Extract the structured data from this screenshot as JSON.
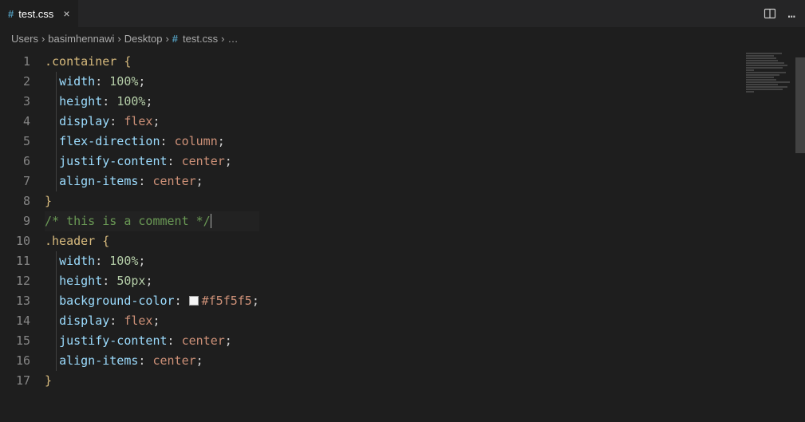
{
  "tab": {
    "icon_label": "#",
    "filename": "test.css",
    "close_glyph": "×"
  },
  "actions": {
    "split": "split-editor",
    "more": "…"
  },
  "breadcrumbs": {
    "seg1": "Users",
    "seg2": "basimhennawi",
    "seg3": "Desktop",
    "file_icon": "#",
    "seg4": "test.css",
    "tail": "…",
    "sep": "›"
  },
  "gutter": {
    "l1": "1",
    "l2": "2",
    "l3": "3",
    "l4": "4",
    "l5": "5",
    "l6": "6",
    "l7": "7",
    "l8": "8",
    "l9": "9",
    "l10": "10",
    "l11": "11",
    "l12": "12",
    "l13": "13",
    "l14": "14",
    "l15": "15",
    "l16": "16",
    "l17": "17"
  },
  "code": {
    "l1": {
      "selector": ".container",
      "sp": " ",
      "brace": "{"
    },
    "l2": {
      "indent": "  ",
      "prop": "width",
      "colon": ": ",
      "val": "100%",
      "semi": ";"
    },
    "l3": {
      "indent": "  ",
      "prop": "height",
      "colon": ": ",
      "val": "100%",
      "semi": ";"
    },
    "l4": {
      "indent": "  ",
      "prop": "display",
      "colon": ": ",
      "val": "flex",
      "semi": ";"
    },
    "l5": {
      "indent": "  ",
      "prop": "flex-direction",
      "colon": ": ",
      "val": "column",
      "semi": ";"
    },
    "l6": {
      "indent": "  ",
      "prop": "justify-content",
      "colon": ": ",
      "val": "center",
      "semi": ";"
    },
    "l7": {
      "indent": "  ",
      "prop": "align-items",
      "colon": ": ",
      "val": "center",
      "semi": ";"
    },
    "l8": {
      "brace": "}"
    },
    "l9": {
      "comment": "/* this is a comment */"
    },
    "l10": {
      "selector": ".header",
      "sp": " ",
      "brace": "{"
    },
    "l11": {
      "indent": "  ",
      "prop": "width",
      "colon": ": ",
      "val": "100%",
      "semi": ";"
    },
    "l12": {
      "indent": "  ",
      "prop": "height",
      "colon": ": ",
      "val": "50px",
      "semi": ";"
    },
    "l13": {
      "indent": "  ",
      "prop": "background-color",
      "colon": ": ",
      "swatch_color": "#f5f5f5",
      "val": "#f5f5f5",
      "semi": ";"
    },
    "l14": {
      "indent": "  ",
      "prop": "display",
      "colon": ": ",
      "val": "flex",
      "semi": ";"
    },
    "l15": {
      "indent": "  ",
      "prop": "justify-content",
      "colon": ": ",
      "val": "center",
      "semi": ";"
    },
    "l16": {
      "indent": "  ",
      "prop": "align-items",
      "colon": ": ",
      "val": "center",
      "semi": ";"
    },
    "l17": {
      "brace": "}"
    }
  }
}
